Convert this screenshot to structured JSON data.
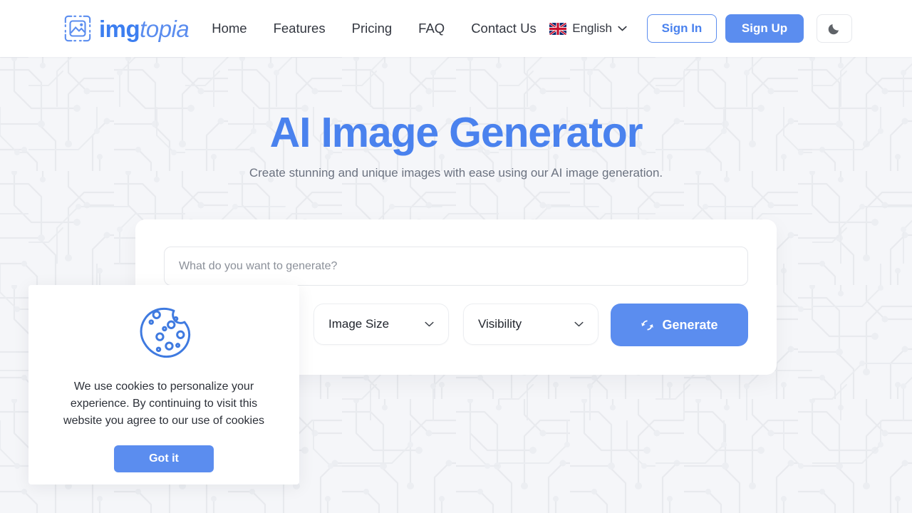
{
  "header": {
    "brand": {
      "primary": "img",
      "secondary": "topia",
      "logo_icon": "image-frame-icon"
    },
    "nav": [
      {
        "label": "Home"
      },
      {
        "label": "Features"
      },
      {
        "label": "Pricing"
      },
      {
        "label": "FAQ"
      },
      {
        "label": "Contact Us"
      }
    ],
    "language": {
      "label": "English",
      "flag_icon": "uk-flag-icon",
      "chevron_icon": "chevron-down-icon"
    },
    "sign_in_label": "Sign In",
    "sign_up_label": "Sign Up",
    "theme_toggle_icon": "moon-icon"
  },
  "hero": {
    "title": "AI Image Generator",
    "subtitle": "Create stunning and unique images with ease using our AI image generation."
  },
  "generator": {
    "prompt_placeholder": "What do you want to generate?",
    "prompt_value": "",
    "size_select": {
      "label": "Image Size",
      "chevron_icon": "chevron-down-icon"
    },
    "visibility_select": {
      "label": "Visibility",
      "chevron_icon": "chevron-down-icon"
    },
    "generate_label": "Generate",
    "generate_icon": "sync-refresh-icon"
  },
  "cookie_banner": {
    "icon": "cookie-icon",
    "message": "We use cookies to personalize your experience. By continuing to visit this website you agree to our use of cookies",
    "accept_label": "Got it"
  },
  "colors": {
    "accent": "#5b8def",
    "accent_dark": "#4a82ee",
    "page_bg": "#f5f6f9",
    "text": "#333740",
    "muted_text": "#6b7280"
  }
}
